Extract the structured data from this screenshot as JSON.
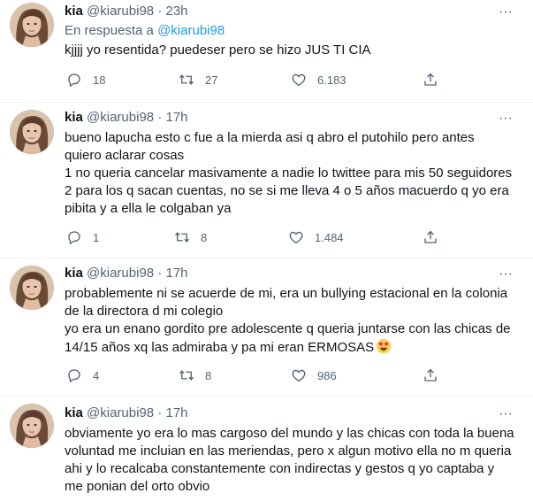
{
  "tweets": [
    {
      "name": "kia",
      "handle": "@kiarubi98",
      "dot": "·",
      "time": "23h",
      "reply_prefix": "En respuesta a",
      "reply_mention": "@kiarubi98",
      "lines": [
        "kjjjj yo resentida? puedeser pero se hizo JUS TI CIA"
      ],
      "replies": "18",
      "retweets": "27",
      "likes": "6.183"
    },
    {
      "name": "kia",
      "handle": "@kiarubi98",
      "dot": "·",
      "time": "17h",
      "lines": [
        "bueno lapucha esto c fue a la mierda asi q abro el putohilo pero antes",
        "quiero aclarar cosas",
        "1 no queria cancelar masivamente a nadie lo twittee para mis 50 seguidores",
        "2 para los q sacan cuentas, no se si me lleva 4 o 5 años macuerdo q yo era",
        "pibita y a ella le colgaban ya"
      ],
      "replies": "1",
      "retweets": "8",
      "likes": "1.484"
    },
    {
      "name": "kia",
      "handle": "@kiarubi98",
      "dot": "·",
      "time": "17h",
      "lines": [
        "probablemente ni se acuerde de mi, era un bullying estacional en la colonia",
        "de la directora d mi colegio",
        "yo era un enano gordito pre adolescente q queria juntarse con las chicas de",
        "14/15 años xq las admiraba y pa mi eran ERMOSAS"
      ],
      "replies": "4",
      "retweets": "8",
      "likes": "986"
    },
    {
      "name": "kia",
      "handle": "@kiarubi98",
      "dot": "·",
      "time": "17h",
      "lines": [
        "obviamente yo era lo mas cargoso del mundo y las chicas con toda la buena",
        "voluntad me incluian en las meriendas, pero x algun motivo ella no m queria",
        "ahi y lo recalcaba constantemente con indirectas y gestos q yo captaba y",
        "me ponian del orto obvio"
      ]
    }
  ],
  "more_glyph": "···",
  "accent_color": "#1d9bf0",
  "icons": [
    "reply-icon",
    "retweet-icon",
    "like-icon",
    "share-icon",
    "more-icon",
    "heart-eyes-emoji"
  ]
}
